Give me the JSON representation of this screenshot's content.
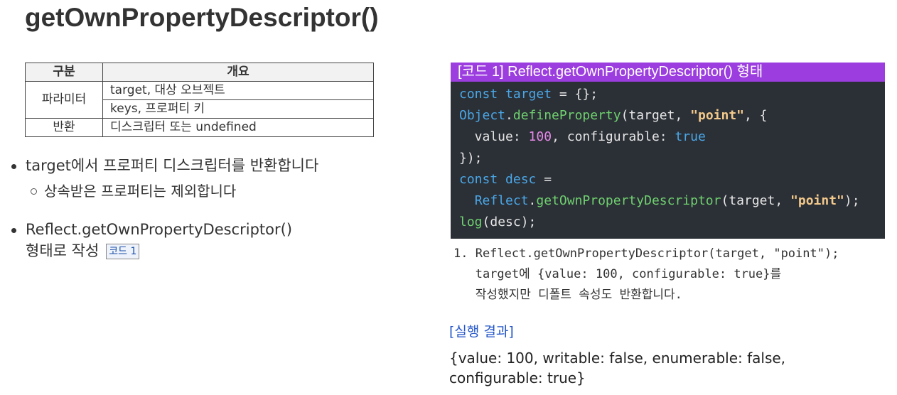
{
  "title": "getOwnPropertyDescriptor()",
  "table": {
    "headers": [
      "구분",
      "개요"
    ],
    "param_label": "파라미터",
    "param_rows": [
      "target, 대상 오브젝트",
      "keys, 프로퍼티 키"
    ],
    "return_label": "반환",
    "return_value": "디스크립터 또는 undefined"
  },
  "bullets": {
    "b1": "target에서 프로퍼티 디스크립터를 반환합니다",
    "b1_sub": "상속받은 프로퍼티는 제외합니다",
    "b2_line1": "Reflect.getOwnPropertyDescriptor()",
    "b2_line2": "형태로 작성",
    "code_tag": "코드 1"
  },
  "code": {
    "title": "[코드 1] Reflect.getOwnPropertyDescriptor() 형태",
    "lines": [
      "const target = {};",
      "Object.defineProperty(target, \"point\", {",
      "  value: 100, configurable: true",
      "});",
      "const desc =",
      "  Reflect.getOwnPropertyDescriptor(target, \"point\");",
      "log(desc);"
    ]
  },
  "note": {
    "line1": "1. Reflect.getOwnPropertyDescriptor(target, \"point\");",
    "line2": "   target에 {value: 100, configurable: true}를",
    "line3": "   작성했지만 디폴트 속성도 반환합니다."
  },
  "result": {
    "label": "[실행 결과]",
    "text": "{value: 100, writable: false, enumerable: false, configurable: true}"
  }
}
